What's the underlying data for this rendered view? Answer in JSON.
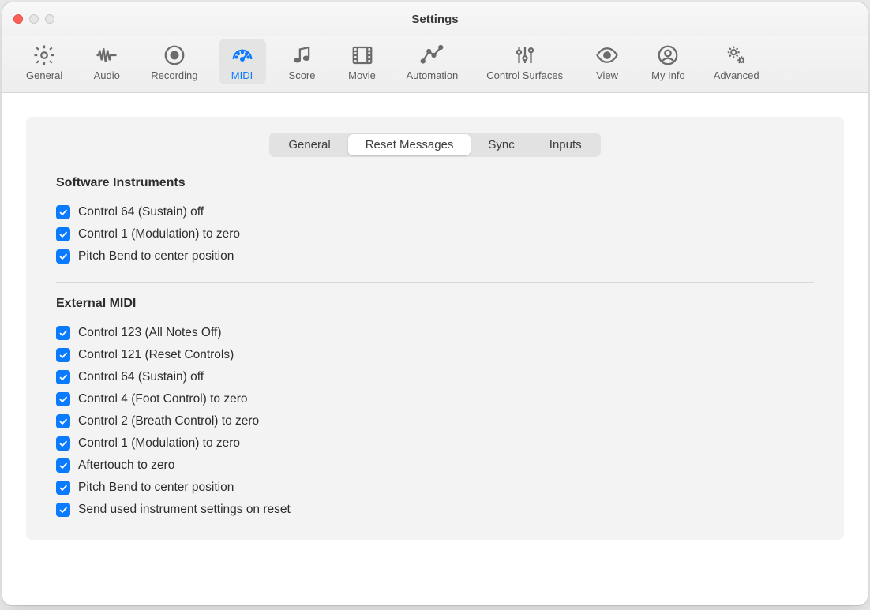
{
  "window": {
    "title": "Settings"
  },
  "toolbar": {
    "items": [
      {
        "id": "general",
        "label": "General",
        "icon": "gear-icon",
        "selected": false
      },
      {
        "id": "audio",
        "label": "Audio",
        "icon": "waveform-icon",
        "selected": false
      },
      {
        "id": "recording",
        "label": "Recording",
        "icon": "record-icon",
        "selected": false
      },
      {
        "id": "midi",
        "label": "MIDI",
        "icon": "gauge-icon",
        "selected": true
      },
      {
        "id": "score",
        "label": "Score",
        "icon": "notes-icon",
        "selected": false
      },
      {
        "id": "movie",
        "label": "Movie",
        "icon": "film-icon",
        "selected": false
      },
      {
        "id": "automation",
        "label": "Automation",
        "icon": "automation-icon",
        "selected": false
      },
      {
        "id": "control-surfaces",
        "label": "Control Surfaces",
        "icon": "sliders-icon",
        "selected": false
      },
      {
        "id": "view",
        "label": "View",
        "icon": "eye-icon",
        "selected": false
      },
      {
        "id": "my-info",
        "label": "My Info",
        "icon": "person-icon",
        "selected": false
      },
      {
        "id": "advanced",
        "label": "Advanced",
        "icon": "gears-icon",
        "selected": false
      }
    ]
  },
  "subtabs": {
    "items": [
      {
        "id": "general",
        "label": "General",
        "active": false
      },
      {
        "id": "reset-messages",
        "label": "Reset Messages",
        "active": true
      },
      {
        "id": "sync",
        "label": "Sync",
        "active": false
      },
      {
        "id": "inputs",
        "label": "Inputs",
        "active": false
      }
    ]
  },
  "sections": {
    "software_instruments": {
      "title": "Software Instruments",
      "items": [
        {
          "label": "Control 64 (Sustain) off",
          "checked": true
        },
        {
          "label": "Control 1 (Modulation) to zero",
          "checked": true
        },
        {
          "label": "Pitch Bend to center position",
          "checked": true
        }
      ]
    },
    "external_midi": {
      "title": "External MIDI",
      "items": [
        {
          "label": "Control 123 (All Notes Off)",
          "checked": true
        },
        {
          "label": "Control 121 (Reset Controls)",
          "checked": true
        },
        {
          "label": "Control 64 (Sustain) off",
          "checked": true
        },
        {
          "label": "Control 4 (Foot Control) to zero",
          "checked": true
        },
        {
          "label": "Control 2 (Breath Control) to zero",
          "checked": true
        },
        {
          "label": "Control 1 (Modulation) to zero",
          "checked": true
        },
        {
          "label": "Aftertouch to zero",
          "checked": true
        },
        {
          "label": "Pitch Bend to center position",
          "checked": true
        },
        {
          "label": "Send used instrument settings on reset",
          "checked": true
        }
      ]
    }
  },
  "colors": {
    "accent": "#0a7aff"
  }
}
